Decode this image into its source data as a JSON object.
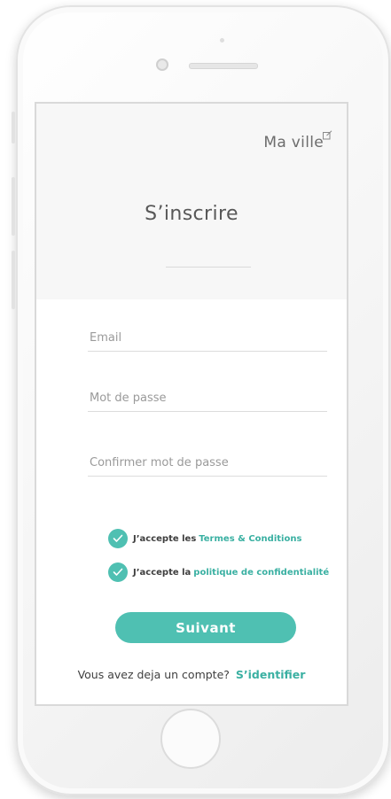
{
  "header": {
    "city": "Ma ville",
    "city_icon": "edit-icon",
    "title": "S’inscrire"
  },
  "form": {
    "email_placeholder": "Email",
    "password_placeholder": "Mot de passe",
    "confirm_placeholder": "Confirmer mot de passe"
  },
  "consents": [
    {
      "prefix": "J’accepte les",
      "link": "Termes & Conditions",
      "checked": true
    },
    {
      "prefix": "J’accepte la",
      "link": "politique de confidentialité",
      "checked": true
    }
  ],
  "actions": {
    "next_label": "Suivant",
    "have_account": "Vous avez deja un compte?",
    "signin_link": "S’identifier"
  },
  "colors": {
    "accent": "#4fc0b2",
    "link": "#3ab0a2",
    "header_bg": "#f7f7f7"
  }
}
